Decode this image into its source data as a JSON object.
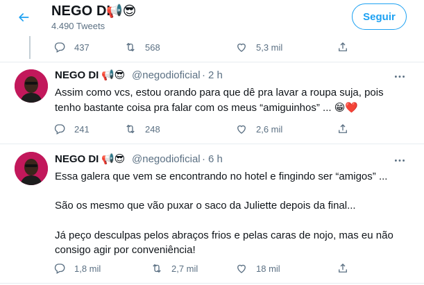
{
  "header": {
    "title": "NEGO DI",
    "title_emoji": "📢😎",
    "tweet_count": "4.490 Tweets",
    "follow_label": "Seguir"
  },
  "top_actions": {
    "replies": "437",
    "retweets": "568",
    "likes": "5,3 mil"
  },
  "tweets": [
    {
      "name": "NEGO DI",
      "name_emoji": "📢😎",
      "handle": "@negodioficial",
      "time": "2 h",
      "lines": [
        "Assim como vcs, estou orando para que dê pra lavar a roupa suja, pois",
        "tenho bastante coisa pra falar com os meus “amiguinhos” ..."
      ],
      "line_emoji": "😁❤️",
      "replies": "241",
      "retweets": "248",
      "likes": "2,6 mil"
    },
    {
      "name": "NEGO DI",
      "name_emoji": "📢😎",
      "handle": "@negodioficial",
      "time": "6 h",
      "lines": [
        "Essa galera que vem se encontrando no hotel e fingindo ser “amigos” ...",
        "São os mesmo que vão puxar o saco da Juliette depois da final...",
        "Já peço desculpas pelos abraços frios e pelas caras de nojo, mas eu não",
        "consigo agir por conveniência!"
      ],
      "replies": "1,8 mil",
      "retweets": "2,7 mil",
      "likes": "18 mil"
    }
  ],
  "colors": {
    "accent": "#1da1f2",
    "muted": "#5b7083",
    "divider": "#e6ecf0"
  },
  "icons": [
    "back-arrow-icon",
    "reply-icon",
    "retweet-icon",
    "like-icon",
    "share-icon",
    "more-icon",
    "avatar"
  ]
}
